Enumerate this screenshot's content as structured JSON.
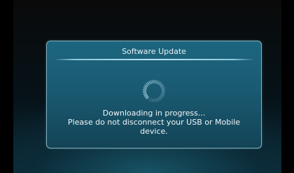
{
  "dialog": {
    "title": "Software Update",
    "lines": [
      "Downloading in progress...",
      "Please do not disconnect your USB or Mobile",
      "device."
    ],
    "spinner_icon": "loading-spinner-icon"
  },
  "colors": {
    "dialog_background": "#1a5a72",
    "dialog_border": "#7fb0c2",
    "divider": "#b8e3f0",
    "text": "#f2f6f8"
  }
}
